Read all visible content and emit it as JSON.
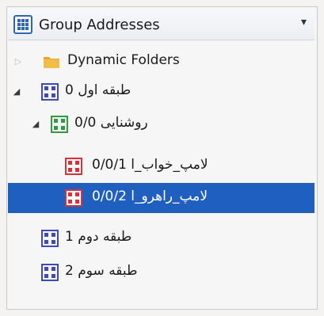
{
  "header": {
    "title": "Group Addresses",
    "icon": "group-addresses-icon",
    "dropdown_icon": "dropdown-arrow-icon"
  },
  "tree": {
    "items": [
      {
        "label": "Dynamic Folders",
        "icon": "folder-icon",
        "expander": "collapsed"
      },
      {
        "label": "طبقه اول 0",
        "icon": "blue-group-icon",
        "expander": "expanded"
      },
      {
        "label": "روشنایی 0/0",
        "icon": "green-group-icon",
        "expander": "expanded"
      },
      {
        "label": "لامپ_خواب_ا 0/0/1",
        "icon": "red-address-icon",
        "expander": "none"
      },
      {
        "label": "لامپ_راهرو_ا 0/0/2",
        "icon": "red-address-icon",
        "expander": "none",
        "selected": true
      },
      {
        "label": "طبقه دوم 1",
        "icon": "blue-group-icon",
        "expander": "none"
      },
      {
        "label": "طبقه سوم 2",
        "icon": "blue-group-icon",
        "expander": "none"
      }
    ]
  },
  "colors": {
    "selection": "#1f5fbf",
    "blue_group": "#3f49b8",
    "green_group": "#2f9a3f",
    "red_address": "#d7323a",
    "folder": "#e6a726"
  }
}
